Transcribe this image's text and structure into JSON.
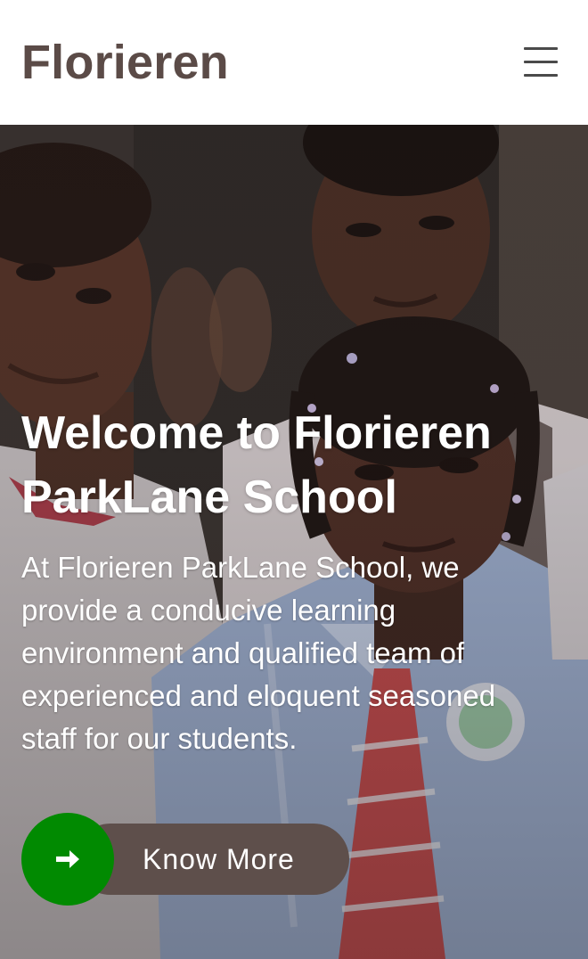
{
  "header": {
    "brand": "Florieren",
    "menu_icon": "hamburger-menu-icon"
  },
  "hero": {
    "title": "Welcome to Florieren ParkLane School",
    "text": "At Florieren ParkLane School, we provide a conducive learning environment and qualified team of experienced and eloquent seasoned staff for our students.",
    "cta_label": "Know More",
    "cta_icon": "arrow-right-icon"
  },
  "colors": {
    "brand_text": "#5b4b47",
    "cta_pill": "#5e4f4b",
    "cta_circle": "#018a01",
    "hero_text": "#ffffff"
  }
}
